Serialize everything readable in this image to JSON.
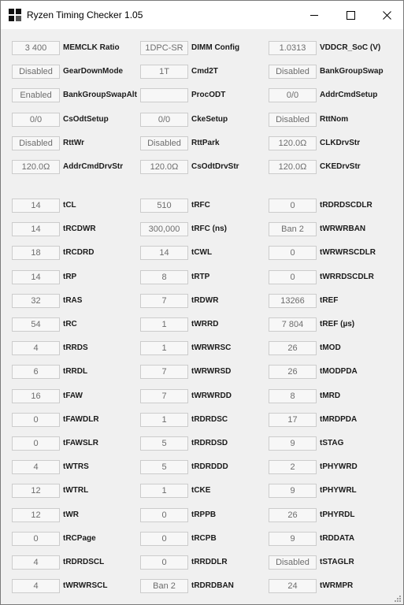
{
  "window": {
    "title": "Ryzen Timing Checker 1.05",
    "controls": {
      "minimize": "minimize",
      "maximize": "maximize",
      "close": "close"
    }
  },
  "top_rows": [
    [
      {
        "value": "3 400",
        "label": "MEMCLK Ratio"
      },
      {
        "value": "1DPC-SR",
        "label": "DIMM Config"
      },
      {
        "value": "1.0313",
        "label": "VDDCR_SoC (V)"
      }
    ],
    [
      {
        "value": "Disabled",
        "label": "GearDownMode"
      },
      {
        "value": "1T",
        "label": "Cmd2T"
      },
      {
        "value": "Disabled",
        "label": "BankGroupSwap"
      }
    ],
    [
      {
        "value": "Enabled",
        "label": "BankGroupSwapAlt"
      },
      {
        "value": "",
        "label": "ProcODT"
      },
      {
        "value": "0/0",
        "label": "AddrCmdSetup"
      }
    ],
    [
      {
        "value": "0/0",
        "label": "CsOdtSetup"
      },
      {
        "value": "0/0",
        "label": "CkeSetup"
      },
      {
        "value": "Disabled",
        "label": "RttNom"
      }
    ],
    [
      {
        "value": "Disabled",
        "label": "RttWr"
      },
      {
        "value": "Disabled",
        "label": "RttPark"
      },
      {
        "value": "120.0Ω",
        "label": "CLKDrvStr"
      }
    ],
    [
      {
        "value": "120.0Ω",
        "label": "AddrCmdDrvStr"
      },
      {
        "value": "120.0Ω",
        "label": "CsOdtDrvStr"
      },
      {
        "value": "120.0Ω",
        "label": "CKEDrvStr"
      }
    ]
  ],
  "timing_rows": [
    [
      {
        "value": "14",
        "label": "tCL"
      },
      {
        "value": "510",
        "label": "tRFC"
      },
      {
        "value": "0",
        "label": "tRDRDSCDLR"
      }
    ],
    [
      {
        "value": "14",
        "label": "tRCDWR"
      },
      {
        "value": "300,000",
        "label": "tRFC (ns)"
      },
      {
        "value": "Ban 2",
        "label": "tWRWRBAN"
      }
    ],
    [
      {
        "value": "18",
        "label": "tRCDRD"
      },
      {
        "value": "14",
        "label": "tCWL"
      },
      {
        "value": "0",
        "label": "tWRWRSCDLR"
      }
    ],
    [
      {
        "value": "14",
        "label": "tRP"
      },
      {
        "value": "8",
        "label": "tRTP"
      },
      {
        "value": "0",
        "label": "tWRRDSCDLR"
      }
    ],
    [
      {
        "value": "32",
        "label": "tRAS"
      },
      {
        "value": "7",
        "label": "tRDWR"
      },
      {
        "value": "13266",
        "label": "tREF"
      }
    ],
    [
      {
        "value": "54",
        "label": "tRC"
      },
      {
        "value": "1",
        "label": "tWRRD"
      },
      {
        "value": "7 804",
        "label": "tREF (µs)"
      }
    ],
    [
      {
        "value": "4",
        "label": "tRRDS"
      },
      {
        "value": "1",
        "label": "tWRWRSC"
      },
      {
        "value": "26",
        "label": "tMOD"
      }
    ],
    [
      {
        "value": "6",
        "label": "tRRDL"
      },
      {
        "value": "7",
        "label": "tWRWRSD"
      },
      {
        "value": "26",
        "label": "tMODPDA"
      }
    ],
    [
      {
        "value": "16",
        "label": "tFAW"
      },
      {
        "value": "7",
        "label": "tWRWRDD"
      },
      {
        "value": "8",
        "label": "tMRD"
      }
    ],
    [
      {
        "value": "0",
        "label": "tFAWDLR"
      },
      {
        "value": "1",
        "label": "tRDRDSC"
      },
      {
        "value": "17",
        "label": "tMRDPDA"
      }
    ],
    [
      {
        "value": "0",
        "label": "tFAWSLR"
      },
      {
        "value": "5",
        "label": "tRDRDSD"
      },
      {
        "value": "9",
        "label": "tSTAG"
      }
    ],
    [
      {
        "value": "4",
        "label": "tWTRS"
      },
      {
        "value": "5",
        "label": "tRDRDDD"
      },
      {
        "value": "2",
        "label": "tPHYWRD"
      }
    ],
    [
      {
        "value": "12",
        "label": "tWTRL"
      },
      {
        "value": "1",
        "label": "tCKE"
      },
      {
        "value": "9",
        "label": "tPHYWRL"
      }
    ],
    [
      {
        "value": "12",
        "label": "tWR"
      },
      {
        "value": "0",
        "label": "tRPPB"
      },
      {
        "value": "26",
        "label": "tPHYRDL"
      }
    ],
    [
      {
        "value": "0",
        "label": "tRCPage"
      },
      {
        "value": "0",
        "label": "tRCPB"
      },
      {
        "value": "9",
        "label": "tRDDATA"
      }
    ],
    [
      {
        "value": "4",
        "label": "tRDRDSCL"
      },
      {
        "value": "0",
        "label": "tRRDDLR"
      },
      {
        "value": "Disabled",
        "label": "tSTAGLR"
      }
    ],
    [
      {
        "value": "4",
        "label": "tWRWRSCL"
      },
      {
        "value": "Ban 2",
        "label": "tRDRDBAN"
      },
      {
        "value": "24",
        "label": "tWRMPR"
      }
    ]
  ]
}
